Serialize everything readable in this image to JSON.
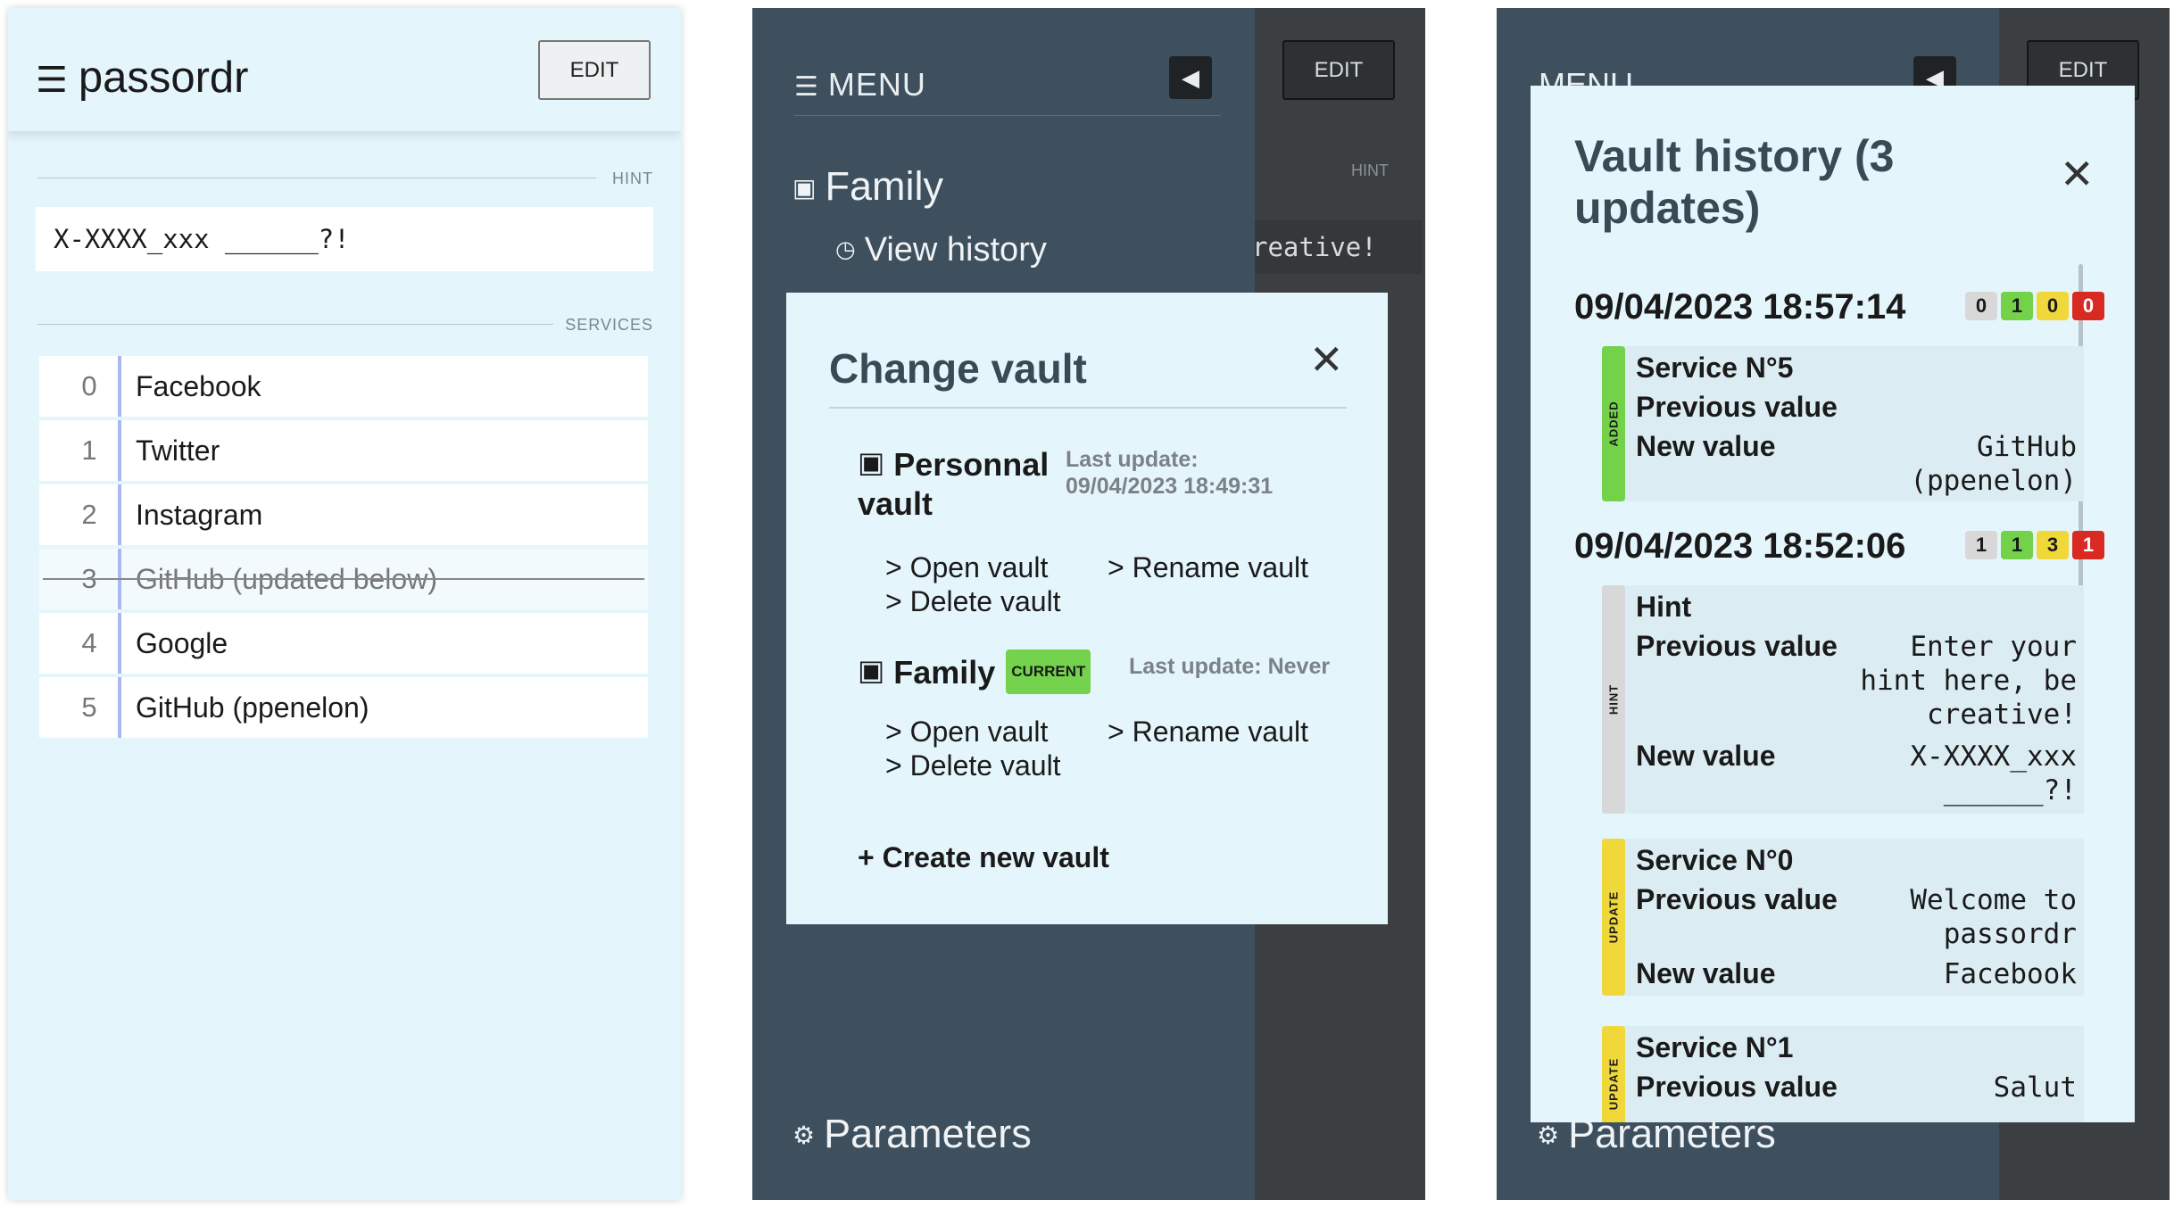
{
  "panel1": {
    "app_title": "passordr",
    "edit_label": "EDIT",
    "hint_label": "HINT",
    "hint_value": "X-XXXX_xxx ______?!",
    "services_label": "SERVICES",
    "services": [
      {
        "num": "0",
        "name": "Facebook"
      },
      {
        "num": "1",
        "name": "Twitter"
      },
      {
        "num": "2",
        "name": "Instagram"
      },
      {
        "num": "3",
        "name": "GitHub (updated below)"
      },
      {
        "num": "4",
        "name": "Google"
      },
      {
        "num": "5",
        "name": "GitHub (ppenelon)"
      }
    ]
  },
  "panel2": {
    "menu_title": "MENU",
    "edit_label": "EDIT",
    "hint_label": "HINT",
    "hint_partial": "reative!",
    "current_vault": "Family",
    "view_history": "View history",
    "parameters": "Parameters",
    "modal": {
      "title": "Change vault",
      "vaults": [
        {
          "name": "Personnal vault",
          "last_update_label": "Last update:",
          "last_update": "09/04/2023 18:49:31",
          "current": false
        },
        {
          "name": "Family",
          "badge": "CURRENT",
          "last_update_label": "Last update:",
          "last_update": "Never",
          "current": true
        }
      ],
      "actions": {
        "open": "> Open vault",
        "rename": "> Rename vault",
        "delete": "> Delete vault"
      },
      "create": "+ Create new vault"
    }
  },
  "panel3": {
    "title": "Vault history (3 updates)",
    "parameters": "Parameters",
    "menu_title": "MENU",
    "edit_label": "EDIT",
    "entries": [
      {
        "date": "09/04/2023 18:57:14",
        "counts": [
          "0",
          "1",
          "0",
          "0"
        ],
        "changes": [
          {
            "tag": "ADDED",
            "title": "Service N°5",
            "prev_label": "Previous value",
            "prev": "",
            "new_label": "New value",
            "new": "GitHub (ppenelon)"
          }
        ]
      },
      {
        "date": "09/04/2023 18:52:06",
        "counts": [
          "1",
          "1",
          "3",
          "1"
        ],
        "changes": [
          {
            "tag": "HINT",
            "title": "Hint",
            "prev_label": "Previous value",
            "prev": "Enter your hint here, be creative!",
            "new_label": "New value",
            "new": "X-XXXX_xxx ______?!"
          },
          {
            "tag": "UPDATE",
            "title": "Service N°0",
            "prev_label": "Previous value",
            "prev": "Welcome to passordr",
            "new_label": "New value",
            "new": "Facebook"
          },
          {
            "tag": "UPDATE",
            "title": "Service N°1",
            "prev_label": "Previous value",
            "prev": "Salut",
            "new_label": "",
            "new": ""
          }
        ]
      }
    ]
  },
  "colors": {
    "panel_bg": "#e5f5fc",
    "drawer_bg": "#3e505e",
    "overlay_bg": "#3b3f42",
    "added": "#73d24a",
    "update": "#f0d83a",
    "deleted": "#d82a22",
    "hint_tag": "#d8d8d8"
  },
  "icons": [
    "menu-icon",
    "vault-icon",
    "clock-icon",
    "gear-icon",
    "close-icon",
    "back-arrow-icon"
  ]
}
